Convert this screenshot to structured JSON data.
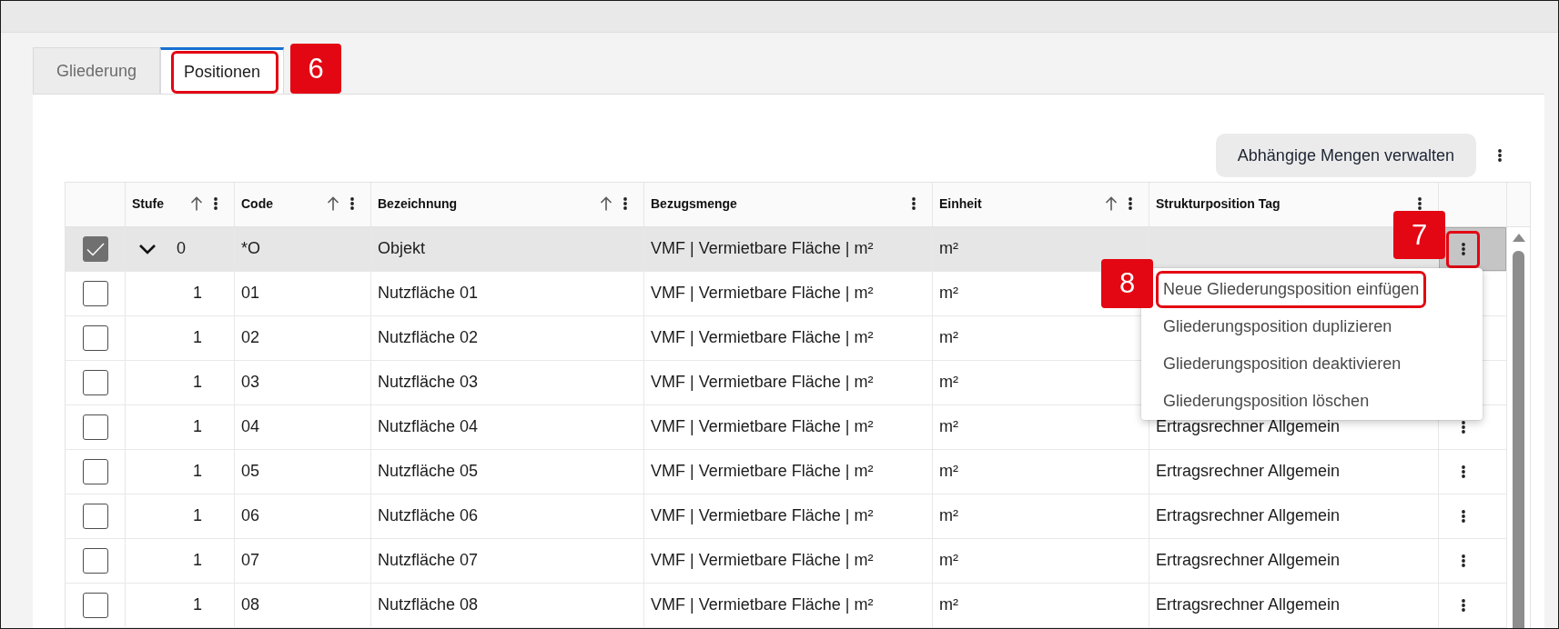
{
  "tabs": [
    {
      "label": "Gliederung",
      "selected": false
    },
    {
      "label": "Positionen",
      "selected": true,
      "callout": "6"
    }
  ],
  "toolbar": {
    "button": "Abhängige Mengen verwalten"
  },
  "table": {
    "columns": [
      {
        "label": "Stufe",
        "sortable": true
      },
      {
        "label": "Code",
        "sortable": true
      },
      {
        "label": "Bezeichnung",
        "sortable": true
      },
      {
        "label": "Bezugsmenge",
        "sortable": false
      },
      {
        "label": "Einheit",
        "sortable": true
      },
      {
        "label": "Strukturposition Tag",
        "sortable": false
      }
    ],
    "rows": [
      {
        "checked": true,
        "selected": true,
        "expanded": true,
        "stufe": "0",
        "code": "*O",
        "bezeichnung": "Objekt",
        "bezugsmenge": "VMF | Vermietbare Fläche | m²",
        "einheit": "m²",
        "action_button": true,
        "callout": "7",
        "menu": [
          {
            "label": "Neue Gliederungsposition einfügen",
            "callout": "8"
          },
          {
            "label": "Gliederungsposition duplizieren"
          },
          {
            "label": "Gliederungsposition deaktivieren"
          },
          {
            "label": "Gliederungsposition löschen"
          }
        ],
        "children": [
          {
            "checked": false,
            "selected": false,
            "stufe": "1",
            "code": "01",
            "bezeichnung": "Nutzfläche 01",
            "bezugsmenge": "VMF | Vermietbare Fläche | m²",
            "einheit": "m²",
            "action_button": false
          },
          {
            "checked": false,
            "selected": false,
            "stufe": "1",
            "code": "02",
            "bezeichnung": "Nutzfläche 02",
            "bezugsmenge": "VMF | Vermietbare Fläche | m²",
            "einheit": "m²",
            "action_button": false
          },
          {
            "checked": false,
            "selected": false,
            "stufe": "1",
            "code": "03",
            "bezeichnung": "Nutzfläche 03",
            "bezugsmenge": "VMF | Vermietbare Fläche | m²",
            "einheit": "m²",
            "action_button": false
          },
          {
            "checked": false,
            "selected": false,
            "stufe": "1",
            "code": "04",
            "bezeichnung": "Nutzfläche 04",
            "bezugsmenge": "VMF | Vermietbare Fläche | m²",
            "einheit": "m²",
            "tag": "Ertragsrechner Allgemein",
            "action_button": true
          },
          {
            "checked": false,
            "selected": false,
            "stufe": "1",
            "code": "05",
            "bezeichnung": "Nutzfläche 05",
            "bezugsmenge": "VMF | Vermietbare Fläche | m²",
            "einheit": "m²",
            "tag": "Ertragsrechner Allgemein",
            "action_button": true
          },
          {
            "checked": false,
            "selected": false,
            "stufe": "1",
            "code": "06",
            "bezeichnung": "Nutzfläche 06",
            "bezugsmenge": "VMF | Vermietbare Fläche | m²",
            "einheit": "m²",
            "tag": "Ertragsrechner Allgemein",
            "action_button": true
          },
          {
            "checked": false,
            "selected": false,
            "stufe": "1",
            "code": "07",
            "bezeichnung": "Nutzfläche 07",
            "bezugsmenge": "VMF | Vermietbare Fläche | m²",
            "einheit": "m²",
            "tag": "Ertragsrechner Allgemein",
            "action_button": true
          },
          {
            "checked": false,
            "selected": false,
            "stufe": "1",
            "code": "08",
            "bezeichnung": "Nutzfläche 08",
            "bezugsmenge": "VMF | Vermietbare Fläche | m²",
            "einheit": "m²",
            "tag": "Ertragsrechner Allgemein",
            "action_button": true
          }
        ]
      }
    ]
  }
}
